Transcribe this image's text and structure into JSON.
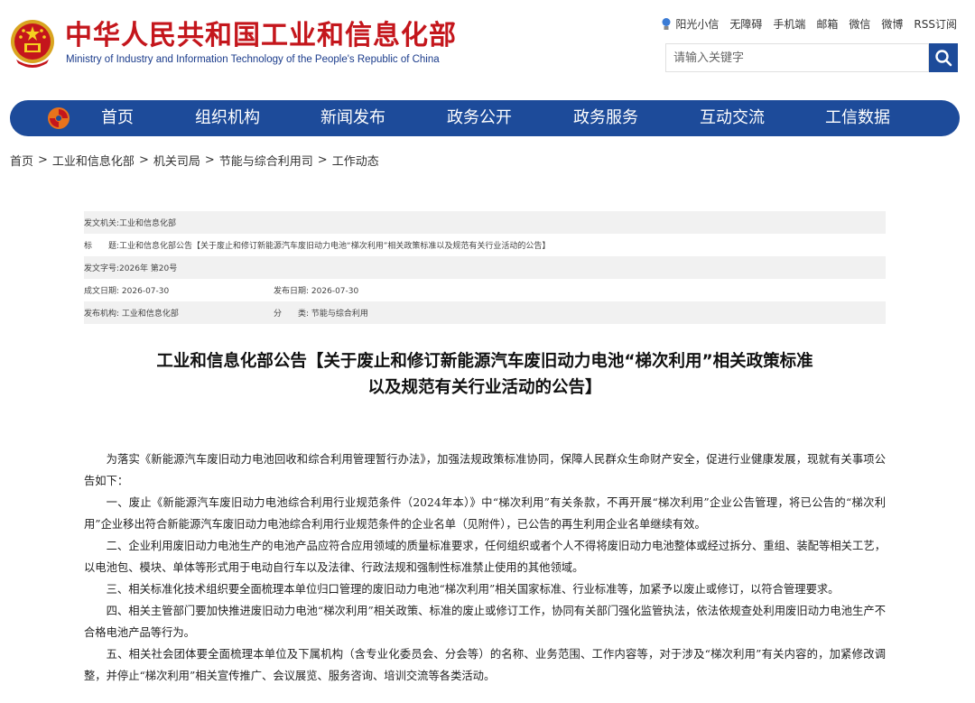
{
  "header": {
    "site_title": "中华人民共和国工业和信息化部",
    "site_subtitle": "Ministry of Industry and Information Technology of the People's Republic of China",
    "top_links": [
      "阳光小信",
      "无障碍",
      "手机端",
      "邮箱",
      "微信",
      "微博",
      "RSS订阅"
    ],
    "search_placeholder": "请输入关键字"
  },
  "nav": {
    "items": [
      "首页",
      "组织机构",
      "新闻发布",
      "政务公开",
      "政务服务",
      "互动交流",
      "工信数据"
    ]
  },
  "breadcrumb": {
    "items": [
      "首页",
      "工业和信息化部",
      "机关司局",
      "节能与综合利用司",
      "工作动态"
    ],
    "separator": ">"
  },
  "meta": {
    "issuer_label": "发文机关:",
    "issuer": "工业和信息化部",
    "title_label": "标　　题:",
    "title": "工业和信息化部公告【关于废止和修订新能源汽车废旧动力电池“梯次利用”相关政策标准以及规范有关行业活动的公告】",
    "doc_no_label": "发文字号:",
    "doc_no": "2026年 第20号",
    "created_label": "成文日期:",
    "created": "2026-07-30",
    "published_label": "发布日期:",
    "published": "2026-07-30",
    "org_label": "发布机构:",
    "org": "工业和信息化部",
    "category_label": "分　　类:",
    "category": "节能与综合利用"
  },
  "article": {
    "title_line1": "工业和信息化部公告【关于废止和修订新能源汽车废旧动力电池“梯次利用”相关政策标准",
    "title_line2": "以及规范有关行业活动的公告】",
    "paragraphs": [
      "为落实《新能源汽车废旧动力电池回收和综合利用管理暂行办法》，加强法规政策标准协同，保障人民群众生命财产安全，促进行业健康发展，现就有关事项公告如下：",
      "一、废止《新能源汽车废旧动力电池综合利用行业规范条件（2024年本）》中“梯次利用”有关条款，不再开展“梯次利用”企业公告管理，将已公告的“梯次利用”企业移出符合新能源汽车废旧动力电池综合利用行业规范条件的企业名单（见附件），已公告的再生利用企业名单继续有效。",
      "二、企业利用废旧动力电池生产的电池产品应符合应用领域的质量标准要求，任何组织或者个人不得将废旧动力电池整体或经过拆分、重组、装配等相关工艺，以电池包、模块、单体等形式用于电动自行车以及法律、行政法规和强制性标准禁止使用的其他领域。",
      "三、相关标准化技术组织要全面梳理本单位归口管理的废旧动力电池“梯次利用”相关国家标准、行业标准等，加紧予以废止或修订，以符合管理要求。",
      "四、相关主管部门要加快推进废旧动力电池“梯次利用”相关政策、标准的废止或修订工作，协同有关部门强化监管执法，依法依规查处利用废旧动力电池生产不合格电池产品等行为。",
      "五、相关社会团体要全面梳理本单位及下属机构（含专业化委员会、分会等）的名称、业务范围、工作内容等，对于涉及“梯次利用”有关内容的，加紧修改调整，并停止“梯次利用”相关宣传推广、会议展览、服务咨询、培训交流等各类活动。"
    ]
  },
  "colors": {
    "brand_red": "#c4161c",
    "nav_blue": "#1d4b9a",
    "meta_shade": "#f1f1f1"
  }
}
